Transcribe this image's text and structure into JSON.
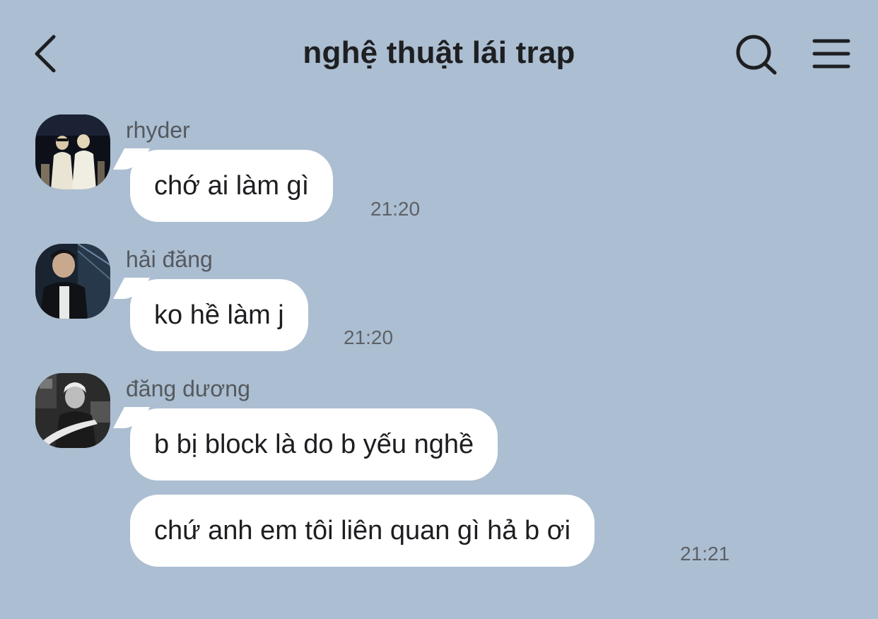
{
  "header": {
    "title": "nghệ thuật lái trap",
    "back_icon": "chevron-left-icon",
    "search_icon": "search-icon",
    "menu_icon": "hamburger-menu-icon"
  },
  "colors": {
    "background": "#acbed1",
    "bubble": "#ffffff"
  },
  "messages": [
    {
      "sender": "rhyder",
      "bubbles": [
        {
          "text": "chớ ai làm gì",
          "time": "21:20"
        }
      ]
    },
    {
      "sender": "hải đăng",
      "bubbles": [
        {
          "text": "ko hề làm j",
          "time": "21:20"
        }
      ]
    },
    {
      "sender": "đăng dương",
      "bubbles": [
        {
          "text": "b bị block là do b yếu nghề",
          "time": ""
        },
        {
          "text": "chứ anh em tôi liên quan gì hả b ơi",
          "time": "21:21"
        }
      ]
    }
  ]
}
